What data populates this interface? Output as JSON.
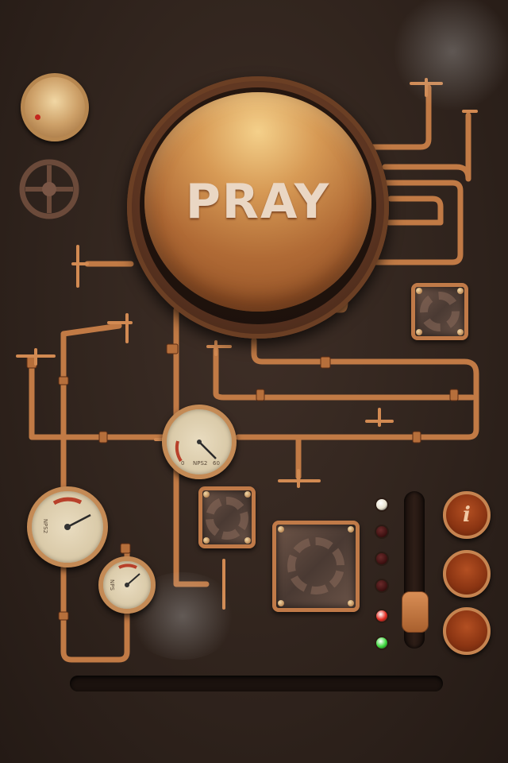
{
  "main_button": {
    "label": "PRAY"
  },
  "gauges": {
    "center": {
      "label": "NPS2",
      "min": "0",
      "max": "60"
    },
    "left_large": {
      "label": "NPS2"
    },
    "left_small": {
      "label": "NPS"
    }
  },
  "controls": {
    "info_button": {
      "icon": "i"
    },
    "slider": {
      "level": 0.15
    }
  },
  "indicators": [
    {
      "name": "led-1",
      "state": "on",
      "color": "#e8e2cf"
    },
    {
      "name": "led-2",
      "state": "off",
      "color": "#3a0f0f"
    },
    {
      "name": "led-3",
      "state": "off",
      "color": "#3a0f0f"
    },
    {
      "name": "led-4",
      "state": "off",
      "color": "#3a0f0f"
    },
    {
      "name": "led-5",
      "state": "on",
      "color": "#e22a1f"
    },
    {
      "name": "led-6",
      "state": "on",
      "color": "#3bd63a"
    }
  ],
  "colors": {
    "copper": "#c7844d",
    "background": "#33261f",
    "button": "#b06a35"
  }
}
